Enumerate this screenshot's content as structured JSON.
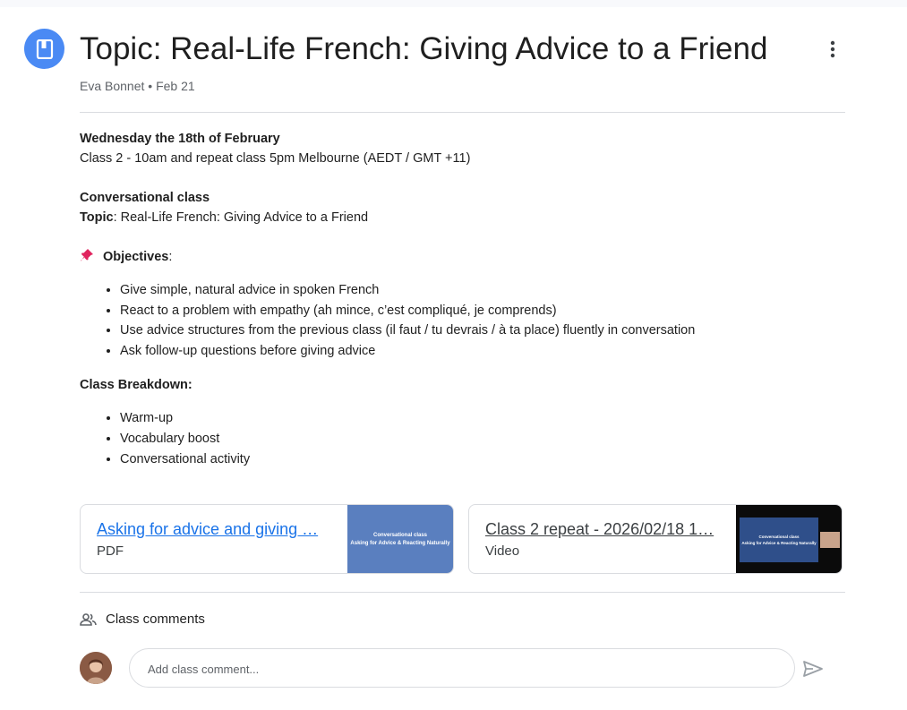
{
  "post": {
    "title": "Topic: Real-Life French: Giving Advice to a Friend",
    "author": "Eva Bonnet",
    "separator": "•",
    "date": "Feb 21"
  },
  "body": {
    "date_heading": "Wednesday the 18th of February",
    "schedule": "Class 2 - 10am and repeat class 5pm Melbourne (AEDT / GMT +11)",
    "class_type": "Conversational class",
    "topic_label": "Topic",
    "topic_value": ": Real-Life French: Giving Advice to a Friend",
    "objectives_label": "Objectives",
    "objectives_colon": ":",
    "objectives": [
      "Give simple, natural advice in spoken French",
      "React to a problem with empathy (ah mince, c’est compliqué, je comprends)",
      "Use advice structures from the previous class (il faut / tu devrais / à ta place) fluently in conversation",
      "Ask follow-up questions before giving advice"
    ],
    "breakdown_label": "Class Breakdown:",
    "breakdown": [
      "Warm-up",
      "Vocabulary boost",
      "Conversational activity"
    ]
  },
  "attachments": [
    {
      "title": "Asking for advice and giving …",
      "type": "PDF",
      "thumb_line1": "Conversational class",
      "thumb_line2": "Asking for Advice & Reacting Naturally",
      "link_color": "#1a73e8"
    },
    {
      "title": "Class 2 repeat - 2026/02/18 1…",
      "type": "Video",
      "thumb_line1": "Conversational class",
      "thumb_line2": "Asking for Advice & Reacting Naturally",
      "link_color": "#3c4043"
    }
  ],
  "comments": {
    "label": "Class comments",
    "placeholder": "Add class comment..."
  },
  "icons": {
    "post": "book-icon",
    "more": "more-vert-icon",
    "pin": "pushpin-icon",
    "people": "people-icon",
    "send": "send-icon"
  },
  "colors": {
    "accent": "#4a8af4",
    "link": "#1a73e8",
    "pdf_thumb": "#5a7fbf",
    "text": "#1f1f1f",
    "muted": "#5f6368"
  }
}
